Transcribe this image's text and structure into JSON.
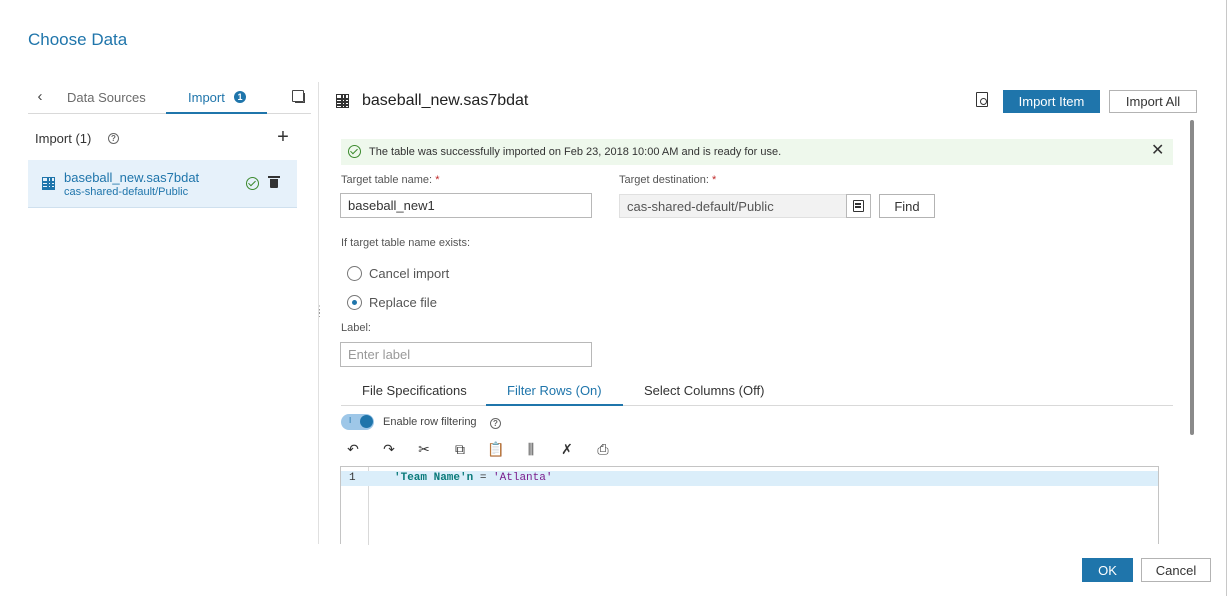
{
  "dialog": {
    "title": "Choose Data"
  },
  "left_pane": {
    "tabs": [
      {
        "label": "Data Sources"
      },
      {
        "label": "Import",
        "badge": "1"
      }
    ],
    "import_heading": "Import (1)",
    "items": [
      {
        "name": "baseball_new.sas7bdat",
        "location": "cas-shared-default/Public"
      }
    ]
  },
  "header": {
    "table_title": "baseball_new.sas7bdat",
    "import_item_label": "Import Item",
    "import_all_label": "Import All"
  },
  "banner": {
    "message": "The table was successfully imported on Feb 23, 2018 10:00 AM and is ready for use."
  },
  "form": {
    "target_name_label": "Target table name:",
    "target_name_value": "baseball_new1",
    "target_dest_label": "Target destination:",
    "target_dest_value": "cas-shared-default/Public",
    "required_mark": "*",
    "find_label": "Find",
    "exists_label": "If target table name exists:",
    "radio_options": [
      {
        "label": "Cancel import",
        "selected": false
      },
      {
        "label": "Replace file",
        "selected": true
      }
    ],
    "label_label": "Label:",
    "label_placeholder": "Enter label"
  },
  "sub_tabs": [
    {
      "label": "File Specifications"
    },
    {
      "label": "Filter Rows (On)",
      "active": true
    },
    {
      "label": "Select Columns (Off)"
    }
  ],
  "filter": {
    "toggle_on": true,
    "toggle_mark": "I",
    "toggle_label": "Enable row filtering"
  },
  "toolbar_icons": [
    "undo-icon",
    "redo-icon",
    "cut-icon",
    "copy-icon",
    "paste-icon",
    "format-icon",
    "clear-icon",
    "print-icon"
  ],
  "editor": {
    "line_number": "1",
    "code_name": "'Team Name'n",
    "code_op": "=",
    "code_value": "'Atlanta'"
  },
  "footer": {
    "ok_label": "OK",
    "cancel_label": "Cancel"
  },
  "colors": {
    "accent": "#1f75ab",
    "success": "#3c8a2e",
    "banner_bg": "#eef8ec"
  }
}
